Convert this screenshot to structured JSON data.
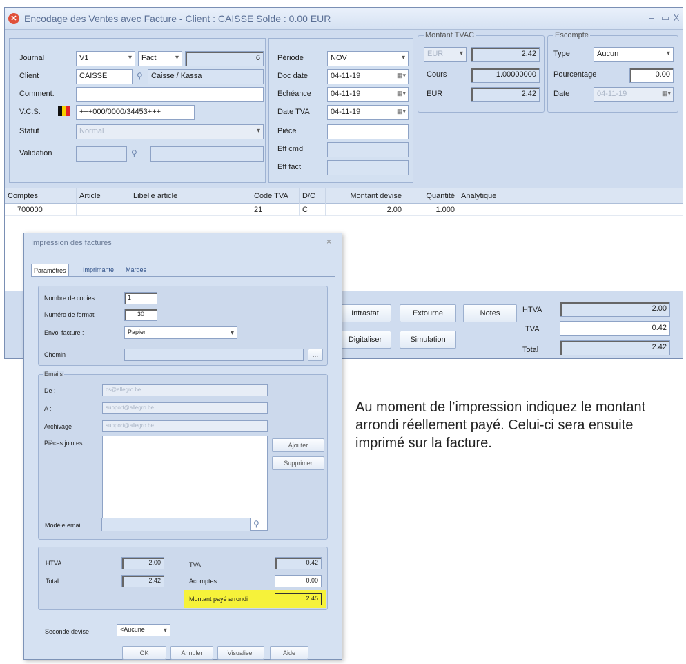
{
  "window": {
    "title": "Encodage des Ventes avec Facture - Client : CAISSE    Solde : 0.00 EUR",
    "controls": [
      "–",
      "▭",
      "X"
    ]
  },
  "header": {
    "journal_label": "Journal",
    "journal_value": "V1",
    "journal_type": "Fact",
    "journal_number": "6",
    "client_label": "Client",
    "client_code": "CAISSE",
    "client_name": "Caisse / Kassa",
    "comment_label": "Comment.",
    "comment_value": "",
    "vcs_label": "V.C.S.",
    "vcs_value": "+++000/0000/34453+++",
    "status_label": "Statut",
    "status_value": "Normal",
    "validation_label": "Validation"
  },
  "dates": {
    "periode_label": "Période",
    "periode_value": "NOV",
    "doc_date_label": "Doc date",
    "doc_date_value": "04-11-19",
    "echeance_label": "Echéance",
    "echeance_value": "04-11-19",
    "date_tva_label": "Date TVA",
    "date_tva_value": "04-11-19",
    "piece_label": "Pièce",
    "piece_value": "",
    "eff_cmd_label": "Eff cmd",
    "eff_fact_label": "Eff fact"
  },
  "tvac": {
    "legend": "Montant TVAC",
    "currency": "EUR",
    "amount": "2.42",
    "cours_label": "Cours",
    "cours_value": "1.00000000",
    "eur_label": "EUR",
    "eur_value": "2.42"
  },
  "escompte": {
    "legend": "Escompte",
    "type_label": "Type",
    "type_value": "Aucun",
    "pct_label": "Pourcentage",
    "pct_value": "0.00",
    "date_label": "Date",
    "date_value": "04-11-19"
  },
  "grid": {
    "columns": [
      "Comptes",
      "Article",
      "Libellé article",
      "Code TVA",
      "D/C",
      "Montant devise",
      "Quantité",
      "Analytique"
    ],
    "rows": [
      [
        "700000",
        "",
        "",
        "21",
        "C",
        "2.00",
        "1.000",
        ""
      ]
    ]
  },
  "actions": {
    "intrastat": "Intrastat",
    "extourne": "Extourne",
    "notes": "Notes",
    "digitaliser": "Digitaliser",
    "simulation": "Simulation"
  },
  "totals": {
    "htva_label": "HTVA",
    "htva_value": "2.00",
    "tva_label": "TVA",
    "tva_value": "0.42",
    "total_label": "Total",
    "total_value": "2.42"
  },
  "dialog": {
    "title": "Impression des factures",
    "close": "×",
    "tabs": [
      "Paramètres",
      "Imprimante",
      "Marges"
    ],
    "copies_label": "Nombre de copies",
    "copies_value": "1",
    "format_label": "Numéro de format",
    "format_value": "30",
    "envoi_label": "Envoi facture :",
    "envoi_value": "Papier",
    "chemin_label": "Chemin",
    "emails_legend": "Emails",
    "de_label": "De :",
    "de_value": "cs@allegro.be",
    "a_label": "A :",
    "a_value": "support@allegro.be",
    "archivage_label": "Archivage",
    "archivage_value": "support@allegro.be",
    "pieces_label": "Pièces jointes",
    "ajouter": "Ajouter",
    "supprimer": "Supprimer",
    "modele_label": "Modèle email",
    "htva_label": "HTVA",
    "htva_value": "2.00",
    "total_label": "Total",
    "total_value": "2.42",
    "tva_label": "TVA",
    "tva_value": "0.42",
    "acomptes_label": "Acomptes",
    "acomptes_value": "0.00",
    "arrondi_label": "Montant payé arrondi",
    "arrondi_value": "2.45",
    "seconde_label": "Seconde devise",
    "seconde_value": "<Aucune",
    "ok": "OK",
    "annuler": "Annuler",
    "visualiser": "Visualiser",
    "aide": "Aide"
  },
  "caption": "Au moment de l’impression indiquez le montant arrondi réellement payé. Celui-ci sera ensuite imprimé sur la facture.",
  "colors": {
    "window_bg": "#cfdcef",
    "highlight": "#f6f23a",
    "app_icon": "#e0503a",
    "belgian_flag": [
      "#111111",
      "#f5d000",
      "#e3242b"
    ]
  }
}
